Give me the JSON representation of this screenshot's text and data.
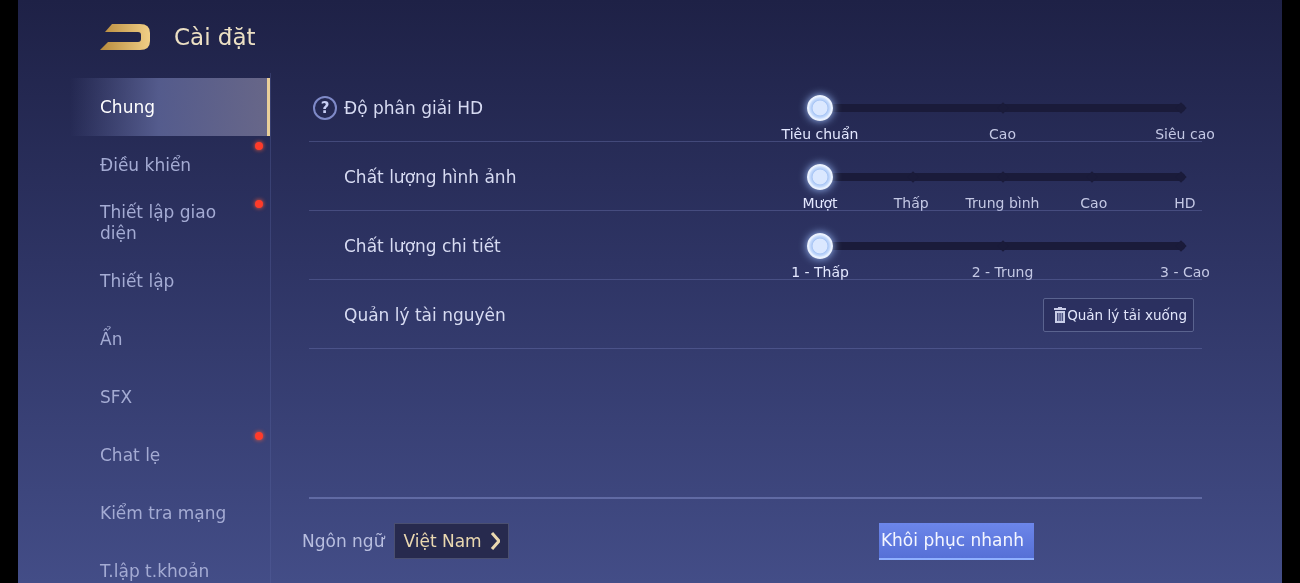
{
  "header": {
    "title": "Cài đặt"
  },
  "sidebar": {
    "items": [
      {
        "label": "Chung",
        "selected": true,
        "badge": false
      },
      {
        "label": "Điều khiển",
        "selected": false,
        "badge": true
      },
      {
        "label": "Thiết lập giao diện",
        "selected": false,
        "badge": true
      },
      {
        "label": "Thiết lập",
        "selected": false,
        "badge": false
      },
      {
        "label": "Ẩn",
        "selected": false,
        "badge": false
      },
      {
        "label": "SFX",
        "selected": false,
        "badge": false
      },
      {
        "label": "Chat lẹ",
        "selected": false,
        "badge": true
      },
      {
        "label": "Kiểm tra mạng",
        "selected": false,
        "badge": false
      },
      {
        "label": "T.lập t.khoản",
        "selected": false,
        "badge": false
      }
    ]
  },
  "settings": [
    {
      "kind": "slider",
      "label": "Độ phân giải HD",
      "help": "?",
      "options": [
        {
          "label": "Tiêu chuẩn",
          "selected": true
        },
        {
          "label": "Cao",
          "selected": false
        },
        {
          "label": "Siêu cao",
          "selected": false
        }
      ]
    },
    {
      "kind": "slider",
      "label": "Chất lượng hình ảnh",
      "options": [
        {
          "label": "Mượt",
          "selected": true
        },
        {
          "label": "Thấp",
          "selected": false
        },
        {
          "label": "Trung bình",
          "selected": false
        },
        {
          "label": "Cao",
          "selected": false
        },
        {
          "label": "HD",
          "selected": false
        }
      ]
    },
    {
      "kind": "slider",
      "label": "Chất lượng chi tiết",
      "options": [
        {
          "label": "1 - Thấp",
          "selected": true
        },
        {
          "label": "2 - Trung",
          "selected": false
        },
        {
          "label": "3 - Cao",
          "selected": false
        }
      ]
    },
    {
      "kind": "button",
      "label": "Quản lý tài nguyên",
      "button": "Quản lý tải xuống"
    }
  ],
  "footer": {
    "language_label": "Ngôn ngữ",
    "language_value": "Việt Nam",
    "reset_button": "Khôi phục nhanh"
  }
}
